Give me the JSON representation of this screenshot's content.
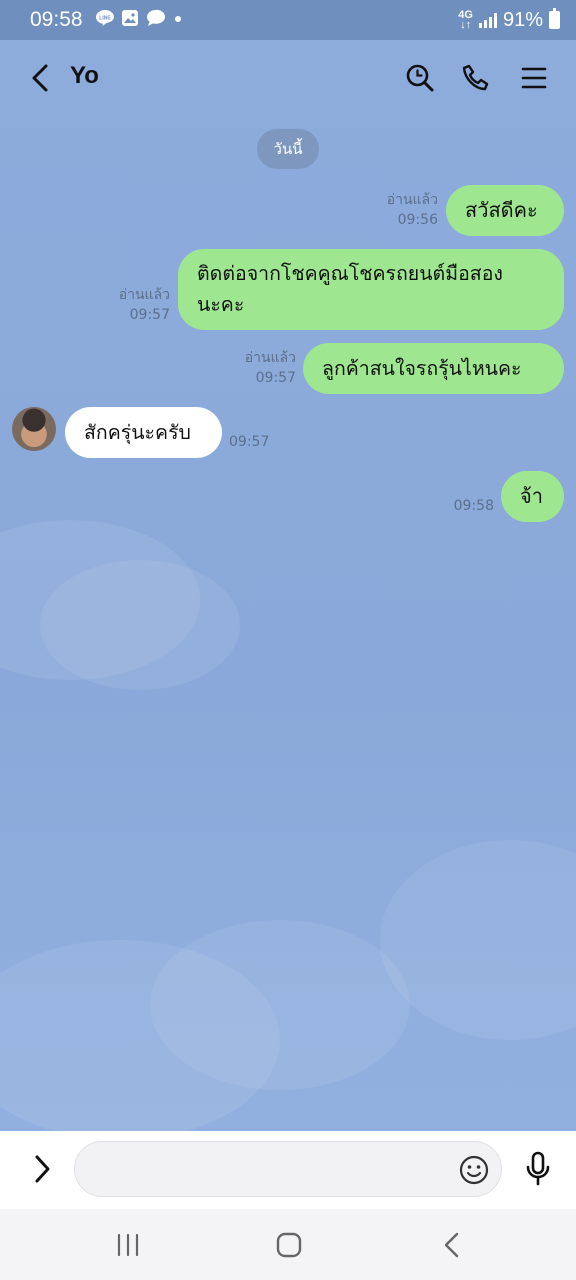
{
  "status_bar": {
    "time": "09:58",
    "notification_icons": [
      "line-icon",
      "image-icon",
      "chat-icon",
      "dot-icon"
    ],
    "network": "4G",
    "battery": "91%"
  },
  "header": {
    "title": "Yo",
    "icons": [
      "back-icon",
      "search-icon",
      "phone-icon",
      "menu-icon"
    ]
  },
  "chat": {
    "date_label": "วันนี้",
    "messages": [
      {
        "direction": "outgoing",
        "text": "สวัสดีคะ",
        "read": "อ่านแล้ว",
        "time": "09:56"
      },
      {
        "direction": "outgoing",
        "text_line1": "ติดต่อจากโชคคูณโชครถยนต์มือสอง",
        "text_line2": "นะคะ",
        "read": "อ่านแล้ว",
        "time": "09:57"
      },
      {
        "direction": "outgoing",
        "text": "ลูกค้าสนใจรถรุ้นไหนคะ",
        "read": "อ่านแล้ว",
        "time": "09:57"
      },
      {
        "direction": "incoming",
        "text": "สักครุ่นะครับ",
        "time": "09:57"
      },
      {
        "direction": "outgoing",
        "text": "จ้า",
        "time": "09:58"
      }
    ]
  },
  "input": {
    "placeholder": "",
    "icons": [
      "expand-icon",
      "emoji-icon",
      "microphone-icon"
    ]
  },
  "nav": {
    "icons": [
      "recent-apps-icon",
      "home-icon",
      "back-nav-icon"
    ]
  }
}
